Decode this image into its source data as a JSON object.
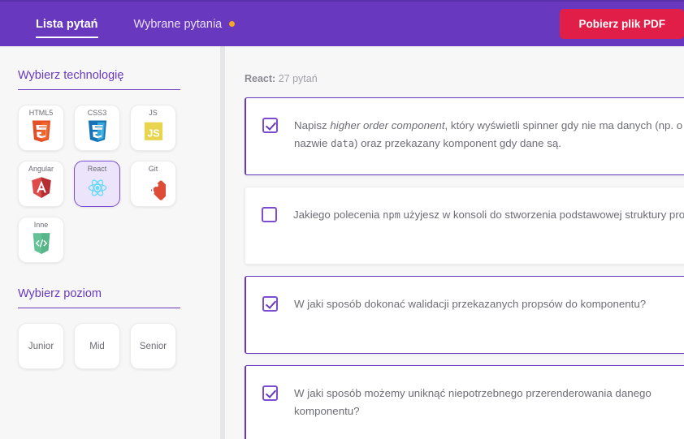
{
  "header": {
    "tabs": [
      {
        "label": "Lista pytań",
        "active": true,
        "dot": false
      },
      {
        "label": "Wybrane pytania",
        "active": false,
        "dot": true
      }
    ],
    "pdf_button_label": "Pobierz plik PDF",
    "secondary_button_label": "",
    "accent_color": "#6839BF",
    "pdf_button_color": "#e01e47",
    "dot_color": "#f5a623"
  },
  "sidebar": {
    "technology_section_title": "Wybierz technologię",
    "technologies": [
      {
        "label": "HTML5",
        "icon": "html5-icon",
        "selected": false
      },
      {
        "label": "CSS3",
        "icon": "css3-icon",
        "selected": false
      },
      {
        "label": "JS",
        "icon": "javascript-icon",
        "selected": false
      },
      {
        "label": "Angular",
        "icon": "angular-icon",
        "selected": false
      },
      {
        "label": "React",
        "icon": "react-icon",
        "selected": true
      },
      {
        "label": "Git",
        "icon": "git-icon",
        "selected": false
      },
      {
        "label": "Inne",
        "icon": "code-shield-icon",
        "selected": false
      }
    ],
    "level_section_title": "Wybierz poziom",
    "levels": [
      {
        "label": "Junior",
        "selected": false
      },
      {
        "label": "Mid",
        "selected": false
      },
      {
        "label": "Senior",
        "selected": false
      }
    ]
  },
  "main": {
    "result_prefix": "React:",
    "result_count": "27 pytań",
    "questions": [
      {
        "checked": true,
        "parts": [
          {
            "t": "Napisz ",
            "style": "normal"
          },
          {
            "t": "higher order component",
            "style": "italic"
          },
          {
            "t": ", który wyświetli spinner gdy nie ma danych (np. o nazwie ",
            "style": "normal"
          },
          {
            "t": "data",
            "style": "code"
          },
          {
            "t": ") oraz przekazany komponent gdy dane są.",
            "style": "normal"
          }
        ]
      },
      {
        "checked": false,
        "parts": [
          {
            "t": "Jakiego polecenia ",
            "style": "normal"
          },
          {
            "t": "npm",
            "style": "code"
          },
          {
            "t": " użyjesz w konsoli do stworzenia podstawowej struktury projektu?",
            "style": "normal"
          }
        ]
      },
      {
        "checked": true,
        "parts": [
          {
            "t": "W jaki sposób dokonać walidacji przekazanych propsów do komponentu?",
            "style": "normal"
          }
        ]
      },
      {
        "checked": true,
        "parts": [
          {
            "t": "W jaki sposób możemy uniknąć niepotrzebnego przerenderowania danego komponentu?",
            "style": "normal"
          }
        ]
      }
    ]
  }
}
